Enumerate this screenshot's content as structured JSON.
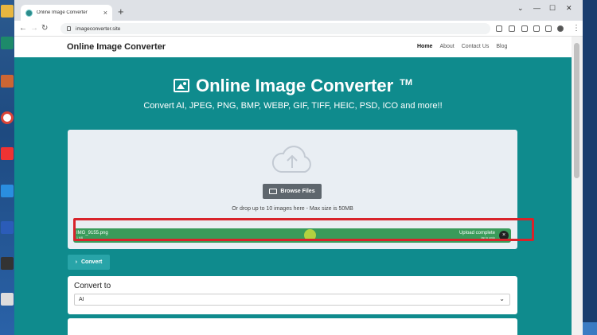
{
  "browser": {
    "tab_title": "Online Image Converter",
    "tab_close": "×",
    "new_tab": "+",
    "url": "imageconverter.site",
    "win_minimize": "—",
    "win_maximize": "☐",
    "win_close": "✕"
  },
  "site": {
    "brand": "Online Image Converter",
    "nav": [
      "Home",
      "About",
      "Contact Us",
      "Blog"
    ],
    "hero_title": "Online Image Converter",
    "trademark": "TM",
    "hero_subtitle": "Convert AI, JPEG, PNG, BMP, WEBP, GIF, TIFF, HEIC, PSD, ICO and more!!",
    "browse_label": "Browse Files",
    "drop_hint": "Or drop up to 10 images here - Max size is 50MB",
    "file": {
      "name": "IMG_9155.png",
      "size": "1 MB",
      "status": "Upload complete",
      "undo_hint": "tap to undo",
      "remove": "×"
    },
    "convert_label": "Convert",
    "convert_to_label": "Convert to",
    "convert_to_value": "AI"
  },
  "colors": {
    "page_bg": "#0f8b8d",
    "file_bar": "#3a9b5a",
    "highlight": "#d8232a"
  }
}
